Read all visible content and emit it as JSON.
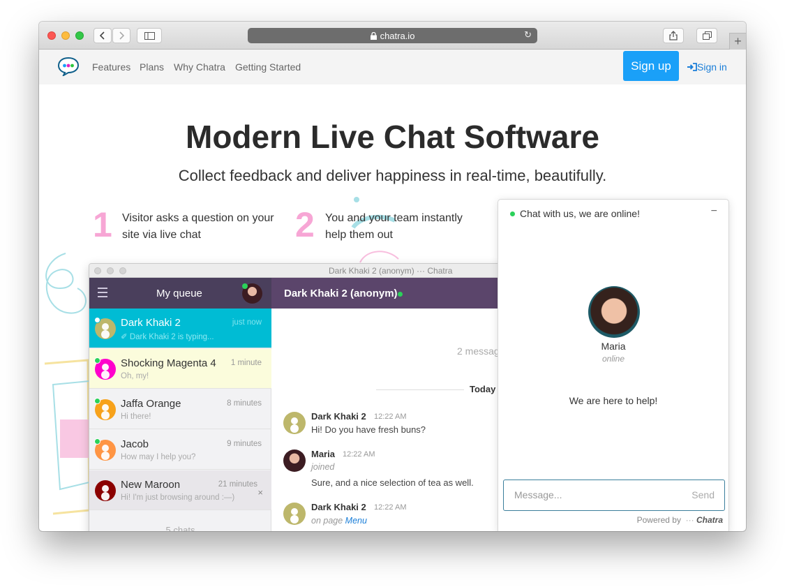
{
  "browser": {
    "url": "chatra.io",
    "back_icon": "chevron-left-icon",
    "forward_icon": "chevron-right-icon",
    "new_tab_label": "+"
  },
  "nav": {
    "links": [
      "Features",
      "Plans",
      "Why Chatra",
      "Getting Started"
    ],
    "signup": "Sign up",
    "signin": "Sign in",
    "brand_colors": [
      "#1aa0f8",
      "#e024c3",
      "#2cc63f"
    ]
  },
  "hero": {
    "title": "Modern Live Chat Software",
    "subtitle": "Collect feedback and deliver happiness in real-time, beautifully."
  },
  "steps": [
    {
      "num": "1",
      "text": "Visitor asks a question on your site via live chat"
    },
    {
      "num": "2",
      "text": "You and your team instantly help them out"
    }
  ],
  "app": {
    "window_title": "Dark Khaki 2 (anonym) ··· Chatra",
    "queue_title": "My queue",
    "conversation_title": "Dark Khaki 2 (anonym)",
    "chats": [
      {
        "name": "Dark Khaki 2",
        "time": "just now",
        "preview": "✐ Dark Khaki 2 is typing...",
        "color": "#bdb76b",
        "bg": "#00bcd4",
        "online": true,
        "active": true
      },
      {
        "name": "Shocking Magenta 4",
        "time": "1 minute",
        "preview": "Oh, my!",
        "color": "#ff00cc",
        "bg": "#fbfcdc",
        "online": true
      },
      {
        "name": "Jaffa Orange",
        "time": "8 minutes",
        "preview": "Hi there!",
        "color": "#f7a21b",
        "bg": "#f2f2f4",
        "online": true
      },
      {
        "name": "Jacob",
        "time": "9 minutes",
        "preview": "How may I help you?",
        "color": "#ff9544",
        "bg": "#f2f2f4",
        "online": true
      },
      {
        "name": "New Maroon",
        "time": "21 minutes",
        "preview": "Hi! I'm just browsing around :—)",
        "color": "#8b0000",
        "bg": "#e8e6ea",
        "online": false,
        "closable": true
      }
    ],
    "chat_count": "5 chats",
    "message_count": "2 messag",
    "today_label": "Today",
    "messages": [
      {
        "name": "Dark Khaki 2",
        "time": "12:22 AM",
        "text": "Hi! Do you have fresh buns?"
      },
      {
        "name": "Maria",
        "time": "12:22 AM",
        "meta": "joined",
        "text": "Sure, and a nice selection of tea as well."
      },
      {
        "name": "Dark Khaki 2",
        "time": "12:22 AM",
        "meta": "on page",
        "link": "Menu"
      }
    ]
  },
  "widget": {
    "header": "Chat with us, we are online!",
    "minimize": "−",
    "agent_name": "Maria",
    "agent_status": "online",
    "greeting": "We are here to help!",
    "placeholder": "Message...",
    "send": "Send",
    "powered_by": "Powered by",
    "brand": "Chatra"
  }
}
